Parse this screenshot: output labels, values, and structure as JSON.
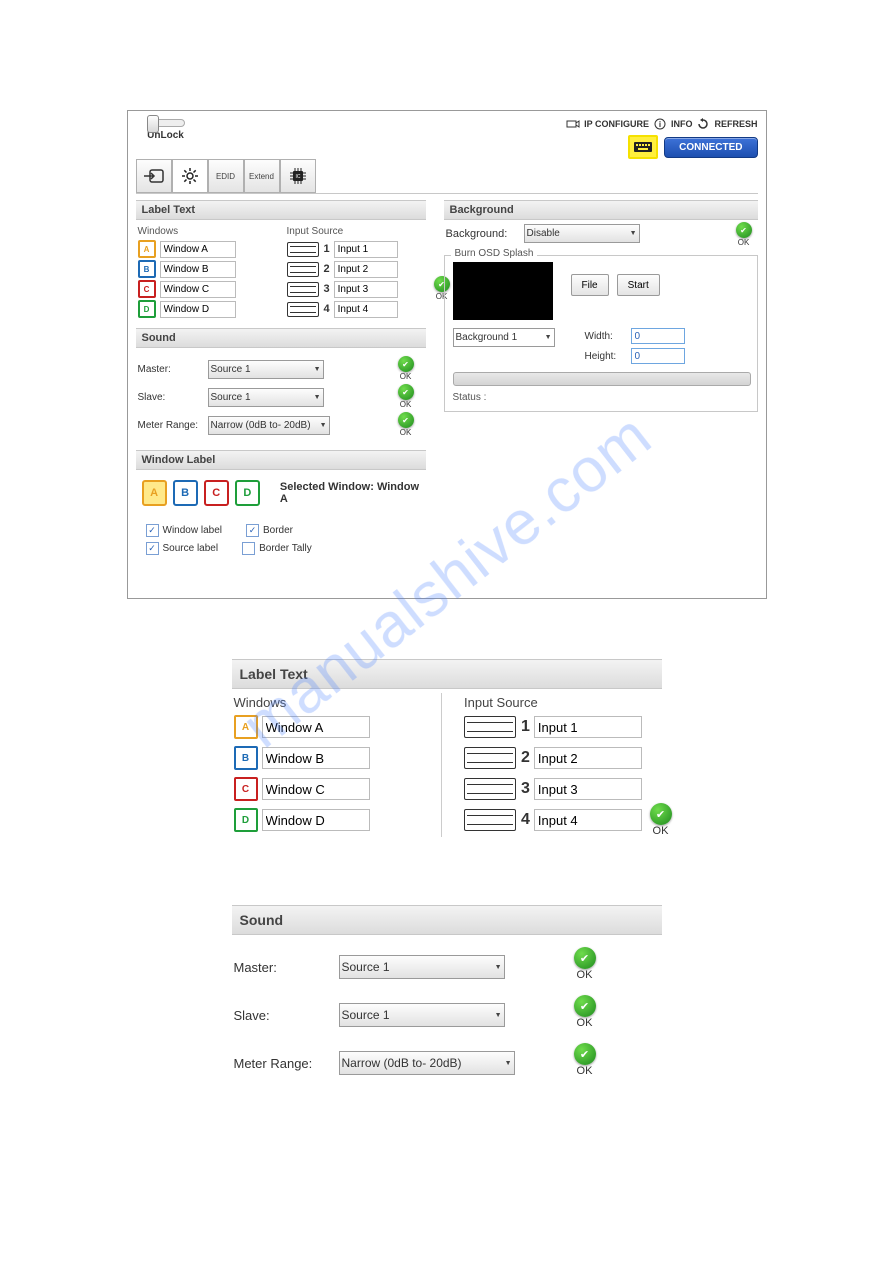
{
  "header": {
    "lock_label": "UnLock",
    "links": {
      "ip_configure": "IP CONFIGURE",
      "info": "INFO",
      "refresh": "REFRESH"
    },
    "connected": "CONNECTED"
  },
  "toolbar": {
    "tabs": [
      "input",
      "settings",
      "EDID",
      "Extend",
      "IC"
    ]
  },
  "label_text": {
    "title": "Label Text",
    "windows_head": "Windows",
    "inputs_head": "Input Source",
    "windows": [
      {
        "letter": "A",
        "label": "Window A",
        "cls": "a"
      },
      {
        "letter": "B",
        "label": "Window B",
        "cls": "b"
      },
      {
        "letter": "C",
        "label": "Window C",
        "cls": "c"
      },
      {
        "letter": "D",
        "label": "Window D",
        "cls": "d"
      }
    ],
    "inputs": [
      {
        "num": "1",
        "label": "Input 1"
      },
      {
        "num": "2",
        "label": "Input 2"
      },
      {
        "num": "3",
        "label": "Input 3"
      },
      {
        "num": "4",
        "label": "Input 4"
      }
    ],
    "ok": "OK"
  },
  "sound": {
    "title": "Sound",
    "master_label": "Master:",
    "slave_label": "Slave:",
    "meter_label": "Meter Range:",
    "master_value": "Source 1",
    "slave_value": "Source 1",
    "meter_value": "Narrow (0dB to- 20dB)",
    "ok": "OK"
  },
  "window_label": {
    "title": "Window Label",
    "selected_prefix": "Selected Window: ",
    "selected_value": "Window A",
    "checks": {
      "window_label": "Window label",
      "source_label": "Source label",
      "border": "Border",
      "border_tally": "Border Tally"
    }
  },
  "background": {
    "title": "Background",
    "label": "Background:",
    "value": "Disable",
    "ok": "OK"
  },
  "osd": {
    "title": "Burn OSD Splash",
    "file_btn": "File",
    "start_btn": "Start",
    "bg_select": "Background 1",
    "width_label": "Width:",
    "width_value": "0",
    "height_label": "Height:",
    "height_value": "0",
    "status_label": "Status :"
  },
  "watermark": "manualshive.com"
}
